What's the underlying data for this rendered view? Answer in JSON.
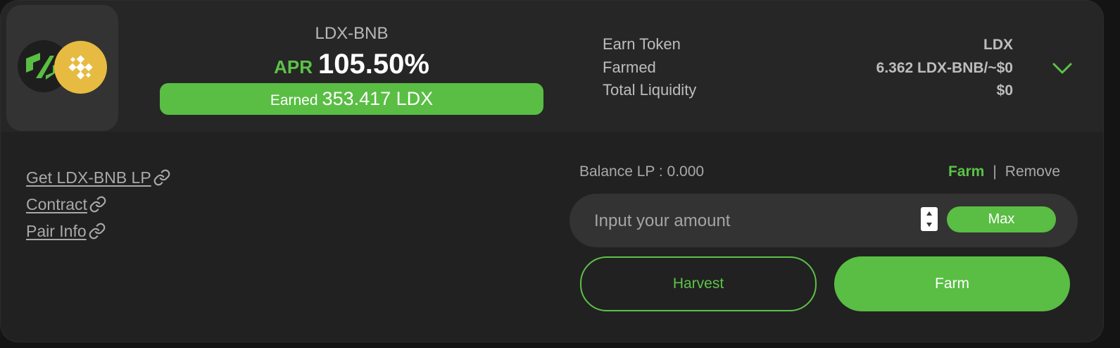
{
  "pool": {
    "pair_name": "LDX-BNB",
    "apr_label": "APR",
    "apr_value": "105.50%",
    "earned_label": "Earned",
    "earned_value": "353.417 LDX",
    "token_icons": [
      "ldx-logo-icon",
      "bnb-logo-icon"
    ]
  },
  "stats": {
    "earn_token_label": "Earn Token",
    "earn_token_value": "LDX",
    "farmed_label": "Farmed",
    "farmed_value": "6.362 LDX-BNB/~$0",
    "total_liquidity_label": "Total Liquidity",
    "total_liquidity_value": "$0"
  },
  "links": {
    "get_lp": "Get LDX-BNB LP",
    "contract": "Contract",
    "pair_info": "Pair Info",
    "icon": "link-icon"
  },
  "action": {
    "balance_text": "Balance LP : 0.000",
    "mode_farm": "Farm",
    "mode_separator": "|",
    "mode_remove": "Remove",
    "amount_placeholder": "Input your amount",
    "amount_value": "",
    "max_label": "Max",
    "harvest_label": "Harvest",
    "farm_label": "Farm"
  },
  "colors": {
    "accent": "#59be43",
    "background": "#212121",
    "header_band": "#262626",
    "bnb_yellow": "#e7bb41"
  }
}
